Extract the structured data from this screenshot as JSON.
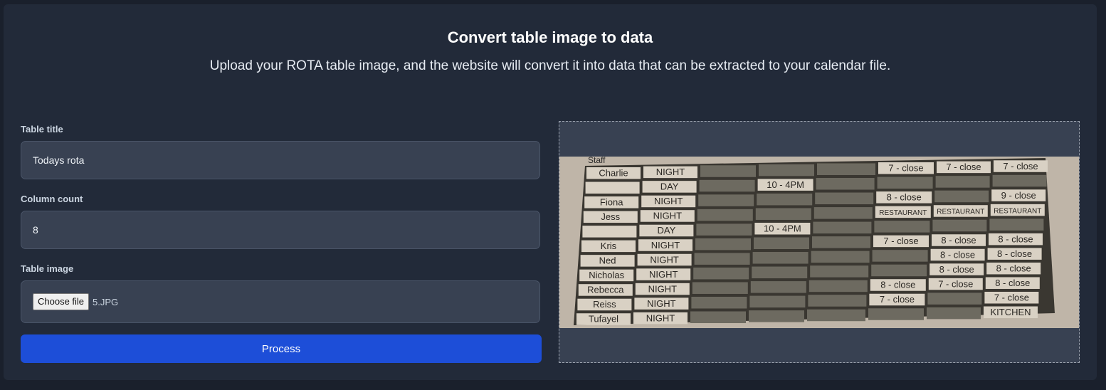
{
  "page": {
    "title": "Convert table image to data",
    "subtitle": "Upload your ROTA table image, and the website will convert it into data that can be extracted to your calendar file."
  },
  "form": {
    "table_title_label": "Table title",
    "table_title_value": "Todays rota",
    "column_count_label": "Column count",
    "column_count_value": "8",
    "table_image_label": "Table image",
    "choose_file_label": "Choose file",
    "file_name": "5.JPG",
    "process_label": "Process"
  },
  "preview_image": {
    "header_fragment": "Staff",
    "rows": [
      {
        "name": "Charlie",
        "shift": "NIGHT",
        "cells": [
          "",
          "",
          "",
          "7 - close",
          "7 - close",
          "7 - close"
        ]
      },
      {
        "name": "",
        "shift": "DAY",
        "cells": [
          "",
          "10 - 4PM",
          "",
          "",
          "",
          ""
        ]
      },
      {
        "name": "Fiona",
        "shift": "NIGHT",
        "cells": [
          "",
          "",
          "",
          "8 - close",
          "",
          "9 - close"
        ]
      },
      {
        "name": "Jess",
        "shift": "NIGHT",
        "cells": [
          "",
          "",
          "",
          "RESTAURANT",
          "RESTAURANT",
          "RESTAURANT"
        ]
      },
      {
        "name": "",
        "shift": "DAY",
        "cells": [
          "",
          "10 - 4PM",
          "",
          "",
          "",
          ""
        ]
      },
      {
        "name": "Kris",
        "shift": "NIGHT",
        "cells": [
          "",
          "",
          "",
          "7 - close",
          "8 - close",
          "8 - close"
        ]
      },
      {
        "name": "Ned",
        "shift": "NIGHT",
        "cells": [
          "",
          "",
          "",
          "",
          "8 - close",
          "8 - close"
        ]
      },
      {
        "name": "Nicholas",
        "shift": "NIGHT",
        "cells": [
          "",
          "",
          "",
          "",
          "8 - close",
          "8 - close"
        ]
      },
      {
        "name": "Rebecca",
        "shift": "NIGHT",
        "cells": [
          "",
          "",
          "",
          "8 - close",
          "7 - close",
          "8 - close"
        ]
      },
      {
        "name": "Reiss",
        "shift": "NIGHT",
        "cells": [
          "",
          "",
          "",
          "7 - close",
          "",
          "7 - close"
        ]
      },
      {
        "name": "Tufayel",
        "shift": "NIGHT",
        "cells": [
          "",
          "",
          "",
          "",
          "",
          "KITCHEN"
        ]
      }
    ]
  }
}
